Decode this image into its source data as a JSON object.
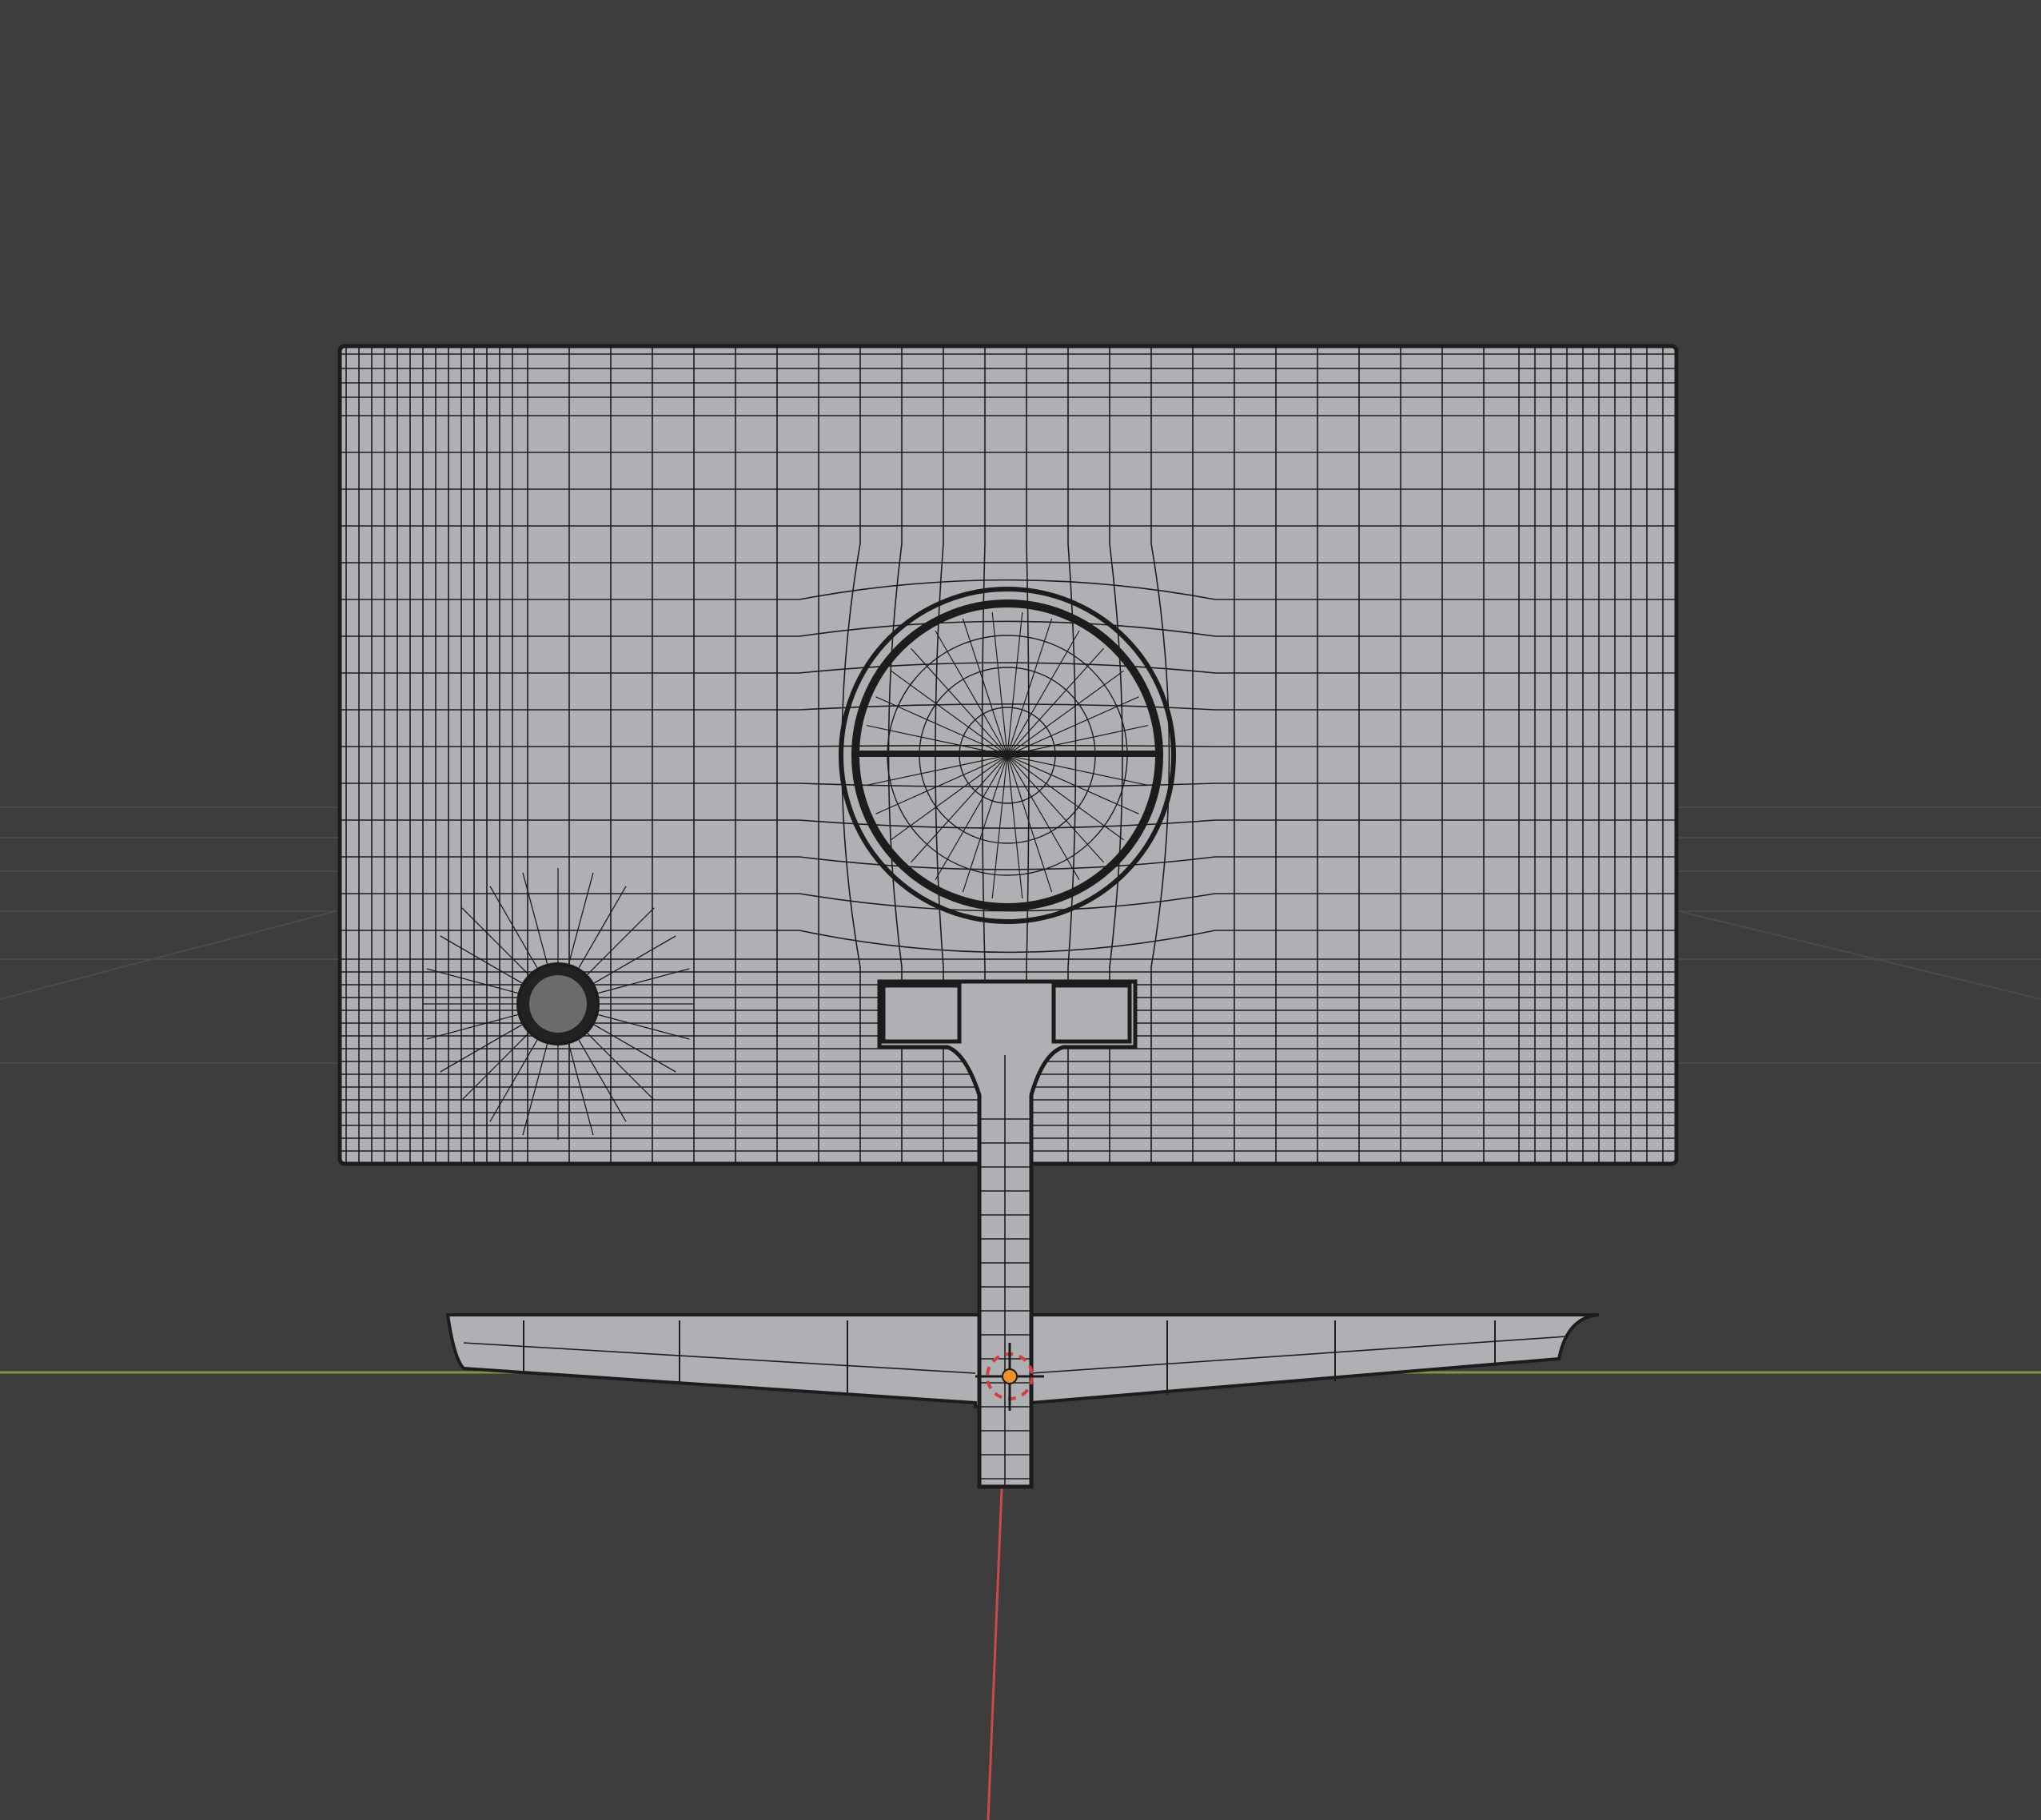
{
  "viewport": {
    "background_color": "#3d3d3d",
    "grid_color": "#4a4a4a",
    "x_axis_color": "#7a9a3a",
    "y_axis_color": "#c84a4a",
    "mesh_fill_color": "#aeb0b3",
    "mesh_wire_color": "#1c1c1c",
    "mesh_dark_color": "#202020",
    "origin_color": "#f0902a",
    "cursor_color": "#d04040"
  },
  "scene": {
    "object": "monitor-mesh",
    "parts": {
      "screen": "screen-back-panel",
      "vesa_mount": "vesa-mount-circle",
      "button": "joystick-button",
      "neck": "stand-neck",
      "base": "stand-base"
    }
  }
}
